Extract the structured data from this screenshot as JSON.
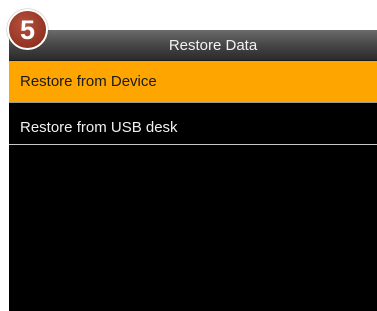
{
  "step_badge": {
    "number": "5"
  },
  "header": {
    "title": "Restore Data"
  },
  "menu": {
    "items": [
      {
        "label": "Restore from Device",
        "selected": true
      },
      {
        "label": "Restore from USB desk",
        "selected": false
      }
    ]
  },
  "colors": {
    "selection": "#ffa500",
    "background": "#000000",
    "badge": "#9b3a28"
  }
}
